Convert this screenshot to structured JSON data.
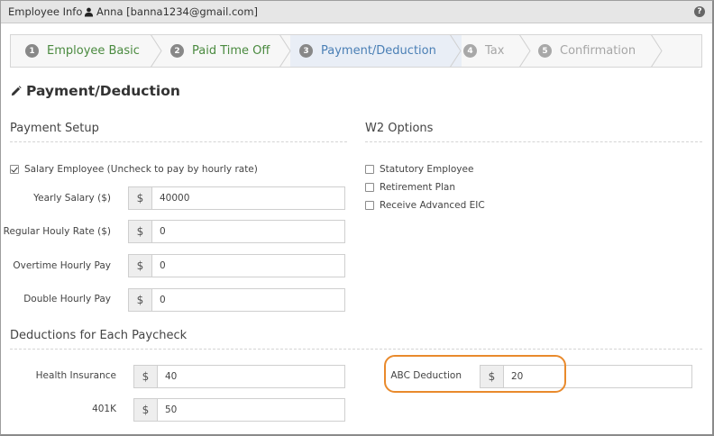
{
  "topbar": {
    "app_title": "Employee Info",
    "user_label": "Anna [banna1234@gmail.com]",
    "help_label": "?"
  },
  "steps": [
    {
      "num": "1",
      "label": "Employee Basic",
      "state": "done"
    },
    {
      "num": "2",
      "label": "Paid Time Off",
      "state": "done"
    },
    {
      "num": "3",
      "label": "Payment/Deduction",
      "state": "active"
    },
    {
      "num": "4",
      "label": "Tax",
      "state": "todo"
    },
    {
      "num": "5",
      "label": "Confirmation",
      "state": "todo"
    }
  ],
  "page_title": "Payment/Deduction",
  "payment_setup": {
    "title": "Payment Setup",
    "salary_checkbox_label": "Salary Employee (Uncheck to pay by hourly rate)",
    "salary_checked": true,
    "fields": [
      {
        "label": "Yearly Salary ($)",
        "prefix": "$",
        "value": "40000"
      },
      {
        "label": "Regular Houly Rate ($)",
        "prefix": "$",
        "value": "0"
      },
      {
        "label": "Overtime Hourly Pay",
        "prefix": "$",
        "value": "0"
      },
      {
        "label": "Double Hourly Pay",
        "prefix": "$",
        "value": "0"
      }
    ]
  },
  "w2_options": {
    "title": "W2 Options",
    "options": [
      {
        "label": "Statutory Employee",
        "checked": false
      },
      {
        "label": "Retirement Plan",
        "checked": false
      },
      {
        "label": "Receive Advanced EIC",
        "checked": false
      }
    ]
  },
  "deductions": {
    "title": "Deductions for Each Paycheck",
    "health_insurance": {
      "label": "Health Insurance",
      "prefix": "$",
      "value": "40"
    },
    "k401": {
      "label": "401K",
      "prefix": "$",
      "value": "50"
    },
    "abc_deduction": {
      "label": "ABC Deduction",
      "prefix": "$",
      "value": "20"
    }
  },
  "colors": {
    "done_step": "#4a8a3f",
    "active_step": "#4a7fb5",
    "highlight": "#e98a2c"
  }
}
